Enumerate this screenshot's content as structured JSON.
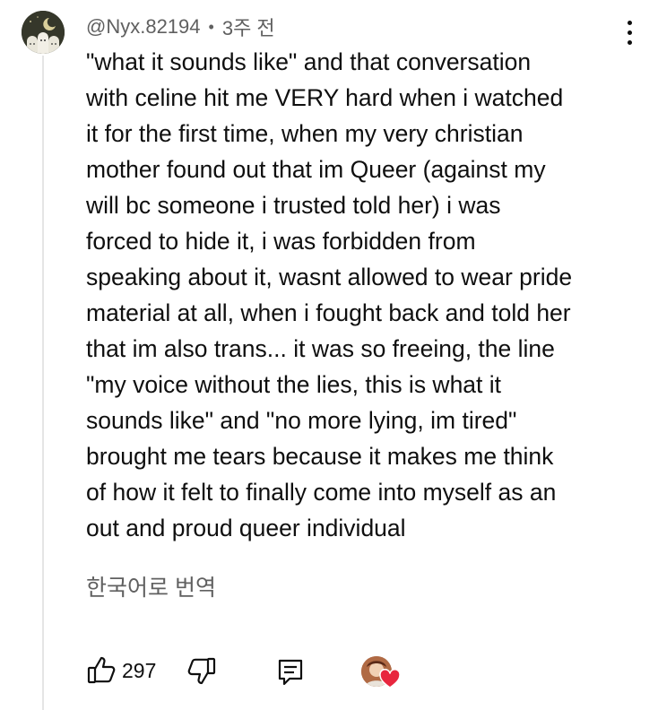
{
  "comment": {
    "author": "@Nyx.82194",
    "separator": "•",
    "time_ago": "3주 전",
    "text": "\"what it sounds like\" and that conversation\nwith celine hit me VERY hard when i watched\nit for the first time, when my very christian\nmother found out that im Queer (against my\nwill bc someone i trusted told her) i was\nforced to hide it, i was forbidden from\nspeaking about it, wasnt allowed to wear pride\nmaterial at all, when i fought back and told her\nthat im also trans... it was so freeing, the line\n\"my voice without the lies, this is what it\nsounds like\" and \"no more lying, im tired\"\nbrought me tears because it makes me think\nof how it felt to finally come into myself as an\nout and proud queer individual",
    "translate_label": "한국어로 번역",
    "like_count": "297"
  },
  "icons": {
    "avatar": "avatar",
    "more": "more-vert-icon",
    "like": "thumbs-up-icon",
    "dislike": "thumbs-down-icon",
    "reply": "reply-icon",
    "creator_heart": "heart-icon"
  },
  "colors": {
    "text": "#0f0f0f",
    "secondary": "#606060",
    "heart": "#e8263e",
    "thread_line": "#e5e5e5"
  }
}
